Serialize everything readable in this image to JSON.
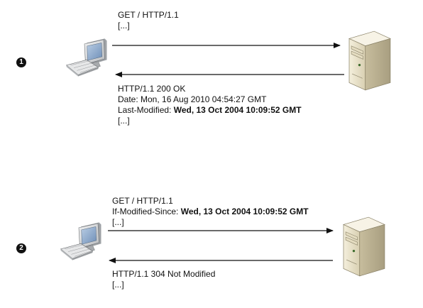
{
  "step1": {
    "badge": "1",
    "request": {
      "line1": "GET / HTTP/1.1",
      "line2": "[...]"
    },
    "response": {
      "status": "HTTP/1.1 200 OK",
      "date": "Date: Mon, 16 Aug 2010 04:54:27 GMT",
      "last_modified_label": "Last-Modified: ",
      "last_modified_value": "Wed, 13 Oct 2004 10:09:52 GMT",
      "ellipsis": "[...]"
    }
  },
  "step2": {
    "badge": "2",
    "request": {
      "line1": "GET / HTTP/1.1",
      "ims_label": "If-Modified-Since: ",
      "ims_value": "Wed, 13 Oct 2004 10:09:52 GMT",
      "ellipsis": "[...]"
    },
    "response": {
      "status": "HTTP/1.1 304 Not Modified",
      "ellipsis": "[...]"
    }
  },
  "icons": {
    "client": "computer-icon",
    "server": "server-icon"
  },
  "colors": {
    "arrow": "#111111",
    "server_body": "#e9e2c9",
    "server_shadow": "#b9b095",
    "monitor_frame": "#d7d9da",
    "monitor_screen": "#8aa6c9"
  }
}
